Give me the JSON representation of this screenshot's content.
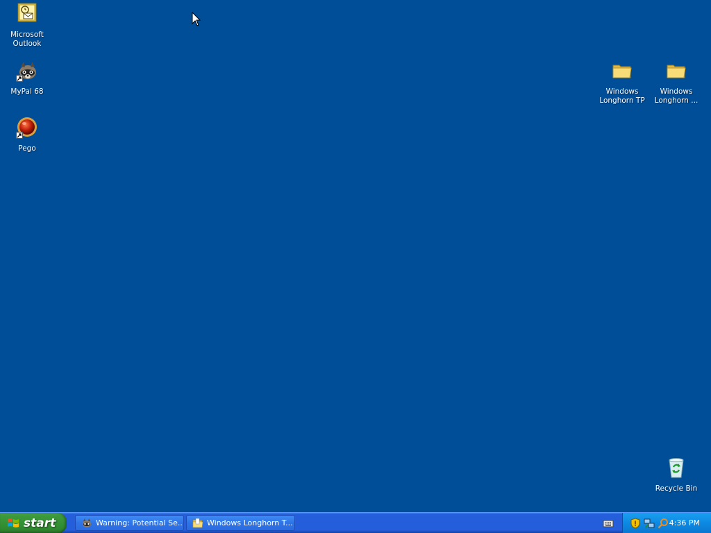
{
  "desktop": {
    "background_color": "#004e98",
    "icons_left": [
      {
        "label": "Microsoft\nOutlook",
        "icon": "outlook-icon"
      },
      {
        "label": "MyPal 68",
        "icon": "raccoon-icon",
        "shortcut": true
      },
      {
        "label": "Pego",
        "icon": "red-ball-icon",
        "shortcut": true
      }
    ],
    "icons_right": [
      {
        "label": "Windows\nLonghorn TP",
        "icon": "folder-icon"
      },
      {
        "label": "Windows\nLonghorn ...",
        "icon": "folder-icon"
      }
    ],
    "recycle_bin": {
      "label": "Recycle Bin",
      "icon": "recycle-bin-icon"
    }
  },
  "taskbar": {
    "start_label": "start",
    "tasks": [
      {
        "label": "Warning: Potential Se...",
        "icon": "raccoon-icon"
      },
      {
        "label": "Windows Longhorn T...",
        "icon": "folder-icon"
      }
    ],
    "tray": {
      "clock": "4:36 PM",
      "icons": [
        "shield-icon",
        "network-icon",
        "search-icon"
      ]
    }
  }
}
